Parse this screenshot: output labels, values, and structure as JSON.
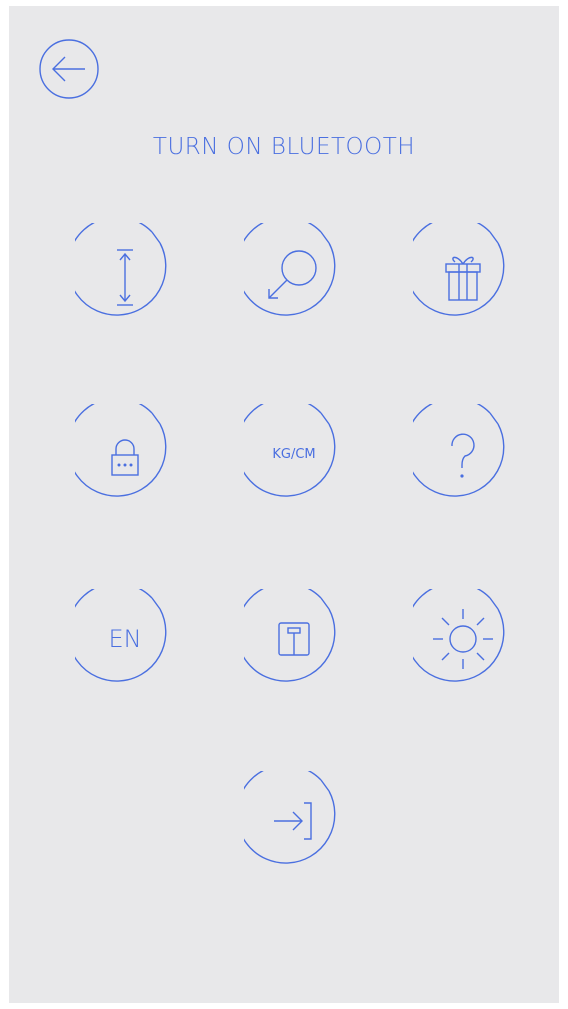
{
  "header": {
    "back_icon": "arrow-left-icon",
    "title": "TURN ON BLUETOOTH"
  },
  "settings": {
    "height": {
      "icon": "height-arrows-icon"
    },
    "rotate": {
      "icon": "circle-arrow-icon"
    },
    "gift": {
      "icon": "gift-icon"
    },
    "lock": {
      "icon": "lock-icon"
    },
    "units": {
      "label": "KG/CM"
    },
    "help": {
      "icon": "question-icon"
    },
    "language": {
      "label": "EN"
    },
    "scale": {
      "icon": "scale-icon"
    },
    "brightness": {
      "icon": "sun-icon"
    },
    "exit": {
      "icon": "exit-icon"
    }
  },
  "colors": {
    "accent": "#4a6fe0",
    "background": "#e8e8ea"
  }
}
